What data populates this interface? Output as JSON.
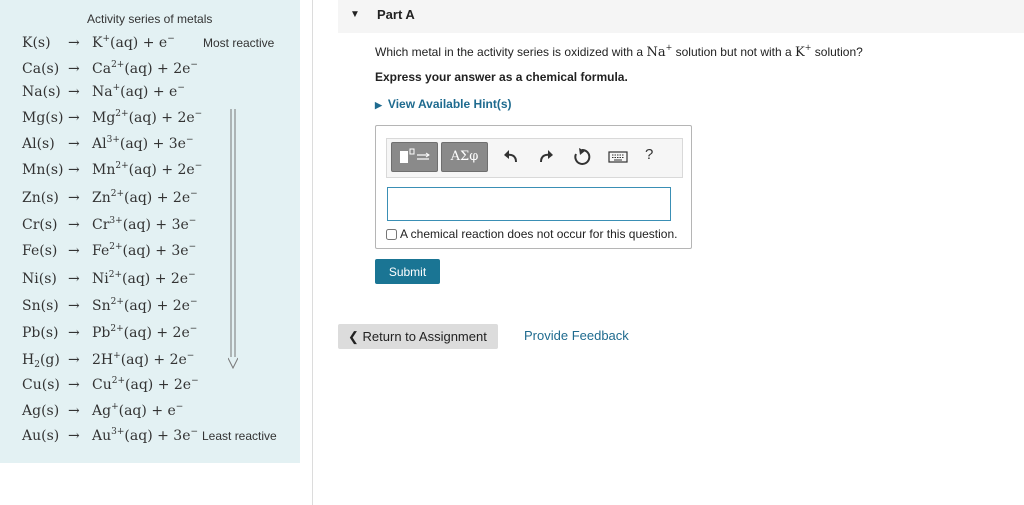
{
  "series": {
    "title": "Activity series of metals",
    "arrow_symbol": "→",
    "most_label": "Most reactive",
    "least_label": "Least reactive",
    "rows": [
      {
        "metal": "K",
        "state": "(s)",
        "ion": "K",
        "charge": "+",
        "electrons": "e",
        "coef": ""
      },
      {
        "metal": "Ca",
        "state": "(s)",
        "ion": "Ca",
        "charge": "2+",
        "electrons": "2e",
        "coef": ""
      },
      {
        "metal": "Na",
        "state": "(s)",
        "ion": "Na",
        "charge": "+",
        "electrons": "e",
        "coef": ""
      },
      {
        "metal": "Mg",
        "state": "(s)",
        "ion": "Mg",
        "charge": "2+",
        "electrons": "2e",
        "coef": ""
      },
      {
        "metal": "Al",
        "state": "(s)",
        "ion": "Al",
        "charge": "3+",
        "electrons": "3e",
        "coef": ""
      },
      {
        "metal": "Mn",
        "state": "(s)",
        "ion": "Mn",
        "charge": "2+",
        "electrons": "2e",
        "coef": ""
      },
      {
        "metal": "Zn",
        "state": "(s)",
        "ion": "Zn",
        "charge": "2+",
        "electrons": "2e",
        "coef": ""
      },
      {
        "metal": "Cr",
        "state": "(s)",
        "ion": "Cr",
        "charge": "3+",
        "electrons": "3e",
        "coef": ""
      },
      {
        "metal": "Fe",
        "state": "(s)",
        "ion": "Fe",
        "charge": "2+",
        "electrons": "3e",
        "coef": ""
      },
      {
        "metal": "Ni",
        "state": "(s)",
        "ion": "Ni",
        "charge": "2+",
        "electrons": "2e",
        "coef": ""
      },
      {
        "metal": "Sn",
        "state": "(s)",
        "ion": "Sn",
        "charge": "2+",
        "electrons": "2e",
        "coef": ""
      },
      {
        "metal": "Pb",
        "state": "(s)",
        "ion": "Pb",
        "charge": "2+",
        "electrons": "2e",
        "coef": ""
      },
      {
        "metal": "H",
        "sub": "2",
        "state": "(g)",
        "ion": "H",
        "charge": "+",
        "electrons": "2e",
        "coef": "2"
      },
      {
        "metal": "Cu",
        "state": "(s)",
        "ion": "Cu",
        "charge": "2+",
        "electrons": "2e",
        "coef": ""
      },
      {
        "metal": "Ag",
        "state": "(s)",
        "ion": "Ag",
        "charge": "+",
        "electrons": "e",
        "coef": ""
      },
      {
        "metal": "Au",
        "state": "(s)",
        "ion": "Au",
        "charge": "3+",
        "electrons": "3e",
        "coef": ""
      }
    ],
    "aq": "(aq)",
    "plus": "+",
    "electron_charge": "−"
  },
  "part": {
    "caret": "▼",
    "title": "Part A"
  },
  "question": {
    "text_before": "Which metal in the activity series is oxidized with a ",
    "ion1": "Na",
    "ion1_charge": "+",
    "text_middle": " solution but not with a ",
    "ion2": "K",
    "ion2_charge": "+",
    "text_after": " solution?"
  },
  "instruction": "Express your answer as a chemical formula.",
  "hint_link": {
    "arrow": "▶",
    "label": "View Available Hint(s)"
  },
  "toolbar": {
    "symbols_label": "ΑΣφ",
    "help_label": "?"
  },
  "answer": {
    "value": "",
    "no_reaction_label": "A chemical reaction does not occur for this question.",
    "no_reaction_checked": false
  },
  "submit_label": "Submit",
  "return_label": "Return to Assignment",
  "return_chevron": "❮",
  "feedback_label": "Provide Feedback",
  "colors": {
    "panel_bg": "#e3f1f3",
    "submit_bg": "#1a7594",
    "link": "#1f6b8f",
    "input_border": "#3a8fb5"
  }
}
